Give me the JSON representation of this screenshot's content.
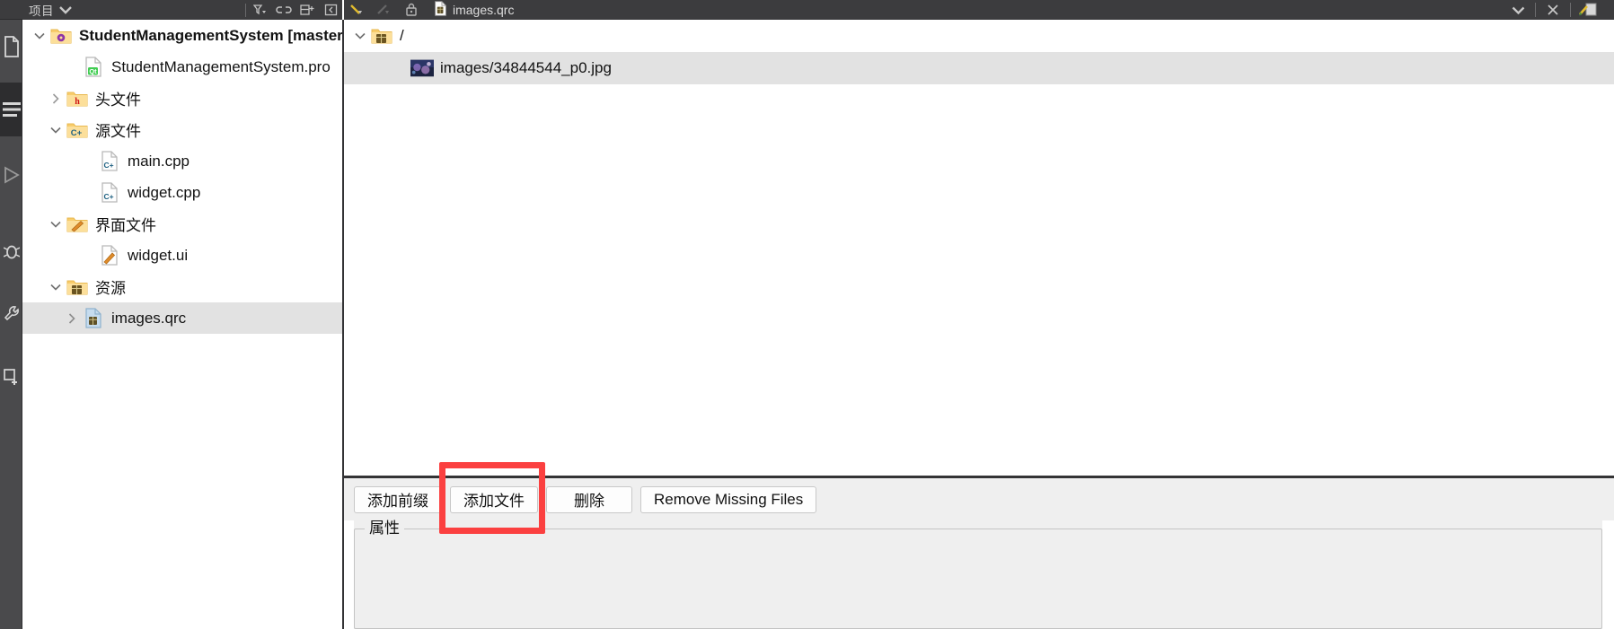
{
  "window": {
    "app": "Qt Creator",
    "accent_red": "#fb4040",
    "toolbar_bg": "#3c3c3e",
    "selection_bg": "#e2e2e2"
  },
  "modebar": {
    "items": [
      {
        "name": "welcome-mode",
        "icon": "document-icon"
      },
      {
        "name": "edit-mode",
        "icon": "lines-icon",
        "active": true
      },
      {
        "name": "design-mode",
        "icon": "play-icon"
      },
      {
        "name": "debug-mode",
        "icon": "bug-icon"
      },
      {
        "name": "projects-mode",
        "icon": "wrench-icon"
      },
      {
        "name": "help-mode",
        "icon": "plus-icon"
      }
    ]
  },
  "project_panel": {
    "combo_label": "项目",
    "header_buttons": [
      {
        "name": "filter-button",
        "icon": "filter-icon"
      },
      {
        "name": "sync-button",
        "icon": "link-icon"
      },
      {
        "name": "split-button",
        "icon": "split-icon"
      },
      {
        "name": "close-button",
        "icon": "close-panel-icon"
      }
    ],
    "tree": [
      {
        "label": "StudentManagementSystem [master]",
        "icon": "project-folder-icon",
        "indent": 0,
        "twist": "down",
        "bold": true,
        "selected": false
      },
      {
        "label": "StudentManagementSystem.pro",
        "icon": "qt-pro-file-icon",
        "indent": 1,
        "twist": "none",
        "bold": false,
        "selected": false
      },
      {
        "label": "头文件",
        "icon": "folder-h-icon",
        "indent": 1,
        "twist": "right",
        "bold": false,
        "selected": false
      },
      {
        "label": "源文件",
        "icon": "folder-cpp-icon",
        "indent": 1,
        "twist": "down",
        "bold": false,
        "selected": false
      },
      {
        "label": "main.cpp",
        "icon": "cpp-file-icon",
        "indent": 2,
        "twist": "none",
        "bold": false,
        "selected": false
      },
      {
        "label": "widget.cpp",
        "icon": "cpp-file-icon",
        "indent": 2,
        "twist": "none",
        "bold": false,
        "selected": false
      },
      {
        "label": "界面文件",
        "icon": "folder-ui-icon",
        "indent": 1,
        "twist": "down",
        "bold": false,
        "selected": false
      },
      {
        "label": "widget.ui",
        "icon": "ui-file-icon",
        "indent": 2,
        "twist": "none",
        "bold": false,
        "selected": false
      },
      {
        "label": "资源",
        "icon": "folder-qrc-icon",
        "indent": 1,
        "twist": "down",
        "bold": false,
        "selected": false
      },
      {
        "label": "images.qrc",
        "icon": "qrc-file-icon",
        "indent": 2,
        "twist": "right",
        "bold": false,
        "selected": true
      }
    ]
  },
  "editor": {
    "toolbar": {
      "back_button": "back-icon",
      "forward_button": "forward-icon",
      "lock_button": "lock-icon",
      "file_icon": "qrc-file-icon",
      "file_name": "images.qrc",
      "dropdown": "chevron-down-icon",
      "close": "close-icon",
      "split_icon": "split-editor-icon"
    },
    "qrc_tree": [
      {
        "label": "/",
        "icon": "folder-qrc-icon",
        "indent": 0,
        "twist": "down",
        "selected": false
      },
      {
        "label": "images/34844544_p0.jpg",
        "icon": "image-thumb-icon",
        "indent": 1,
        "twist": "none",
        "selected": true
      }
    ],
    "buttons": [
      {
        "label": "添加前缀",
        "name": "add-prefix-button",
        "highlighted": false
      },
      {
        "label": "添加文件",
        "name": "add-file-button",
        "highlighted": true
      },
      {
        "label": "删除",
        "name": "remove-button",
        "highlighted": false
      },
      {
        "label": "Remove Missing Files",
        "name": "remove-missing-files-button",
        "highlighted": false
      }
    ],
    "properties_group_title": "属性"
  }
}
